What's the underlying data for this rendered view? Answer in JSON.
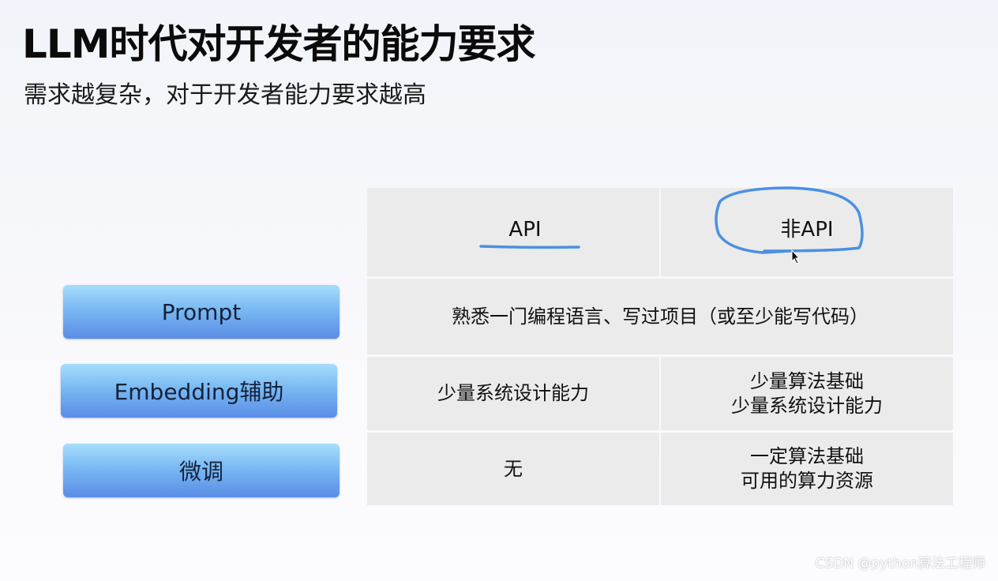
{
  "slide": {
    "title": "LLM时代对开发者的能力要求",
    "subtitle": "需求越复杂，对于开发者能力要求越高"
  },
  "table": {
    "columns": [
      "API",
      "非API"
    ],
    "rows": [
      {
        "label": "Prompt",
        "merged": "熟悉一门编程语言、写过项目（或至少能写代码）"
      },
      {
        "label": "Embedding辅助",
        "api": [
          "少量系统设计能力"
        ],
        "non_api": [
          "少量算法基础",
          "少量系统设计能力"
        ]
      },
      {
        "label": "微调",
        "api": [
          "无"
        ],
        "non_api": [
          "一定算法基础",
          "可用的算力资源"
        ]
      }
    ]
  },
  "annotation": {
    "color": "#4a90e2",
    "highlight": "非API"
  },
  "watermark": "CSDN @python算法工程师"
}
